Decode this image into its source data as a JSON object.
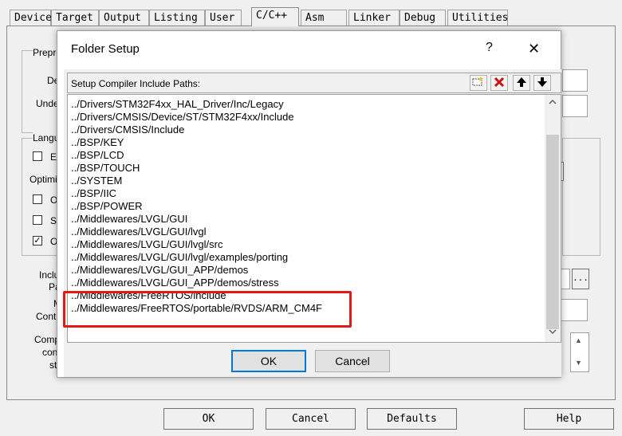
{
  "tabs": [
    "Device",
    "Target",
    "Output",
    "Listing",
    "User",
    "C/C++",
    "Asm",
    "Linker",
    "Debug",
    "Utilities"
  ],
  "active_tab": "C/C++",
  "background": {
    "labels": [
      "Prepro",
      "Def",
      "Undef",
      "Langu",
      "Ex",
      "Optimiz",
      "Op",
      "Sp",
      "On",
      "Inclu",
      "Pat",
      "Mi",
      "Contr",
      "Comp",
      "cont",
      "stri"
    ],
    "browse_label": "...",
    "scroll_up": "▲",
    "scroll_down": "▼"
  },
  "bottom_buttons": {
    "ok": "OK",
    "cancel": "Cancel",
    "defaults": "Defaults",
    "help": "Help"
  },
  "dialog": {
    "title": "Folder Setup",
    "help_glyph": "?",
    "close_glyph": "✕",
    "header_label": "Setup Compiler Include Paths:",
    "toolbar": {
      "new": "new-folder-icon",
      "delete": "delete-icon",
      "move_up": "arrow-up-icon",
      "move_down": "arrow-down-icon"
    },
    "paths": [
      "../Drivers/STM32F4xx_HAL_Driver/Inc/Legacy",
      "../Drivers/CMSIS/Device/ST/STM32F4xx/Include",
      "../Drivers/CMSIS/Include",
      "../BSP/KEY",
      "../BSP/LCD",
      "../BSP/TOUCH",
      "../SYSTEM",
      "../BSP/IIC",
      "../BSP/POWER",
      "../Middlewares/LVGL/GUI",
      "../Middlewares/LVGL/GUI/lvgl",
      "../Middlewares/LVGL/GUI/lvgl/src",
      "../Middlewares/LVGL/GUI/lvgl/examples/porting",
      "../Middlewares/LVGL/GUI_APP/demos",
      "../Middlewares/LVGL/GUI_APP/demos/stress",
      "../Middlewares/FreeRTOS/include",
      "../Middlewares/FreeRTOS/portable/RVDS/ARM_CM4F"
    ],
    "ok_label": "OK",
    "cancel_label": "Cancel",
    "highlight_color": "#e01818"
  }
}
